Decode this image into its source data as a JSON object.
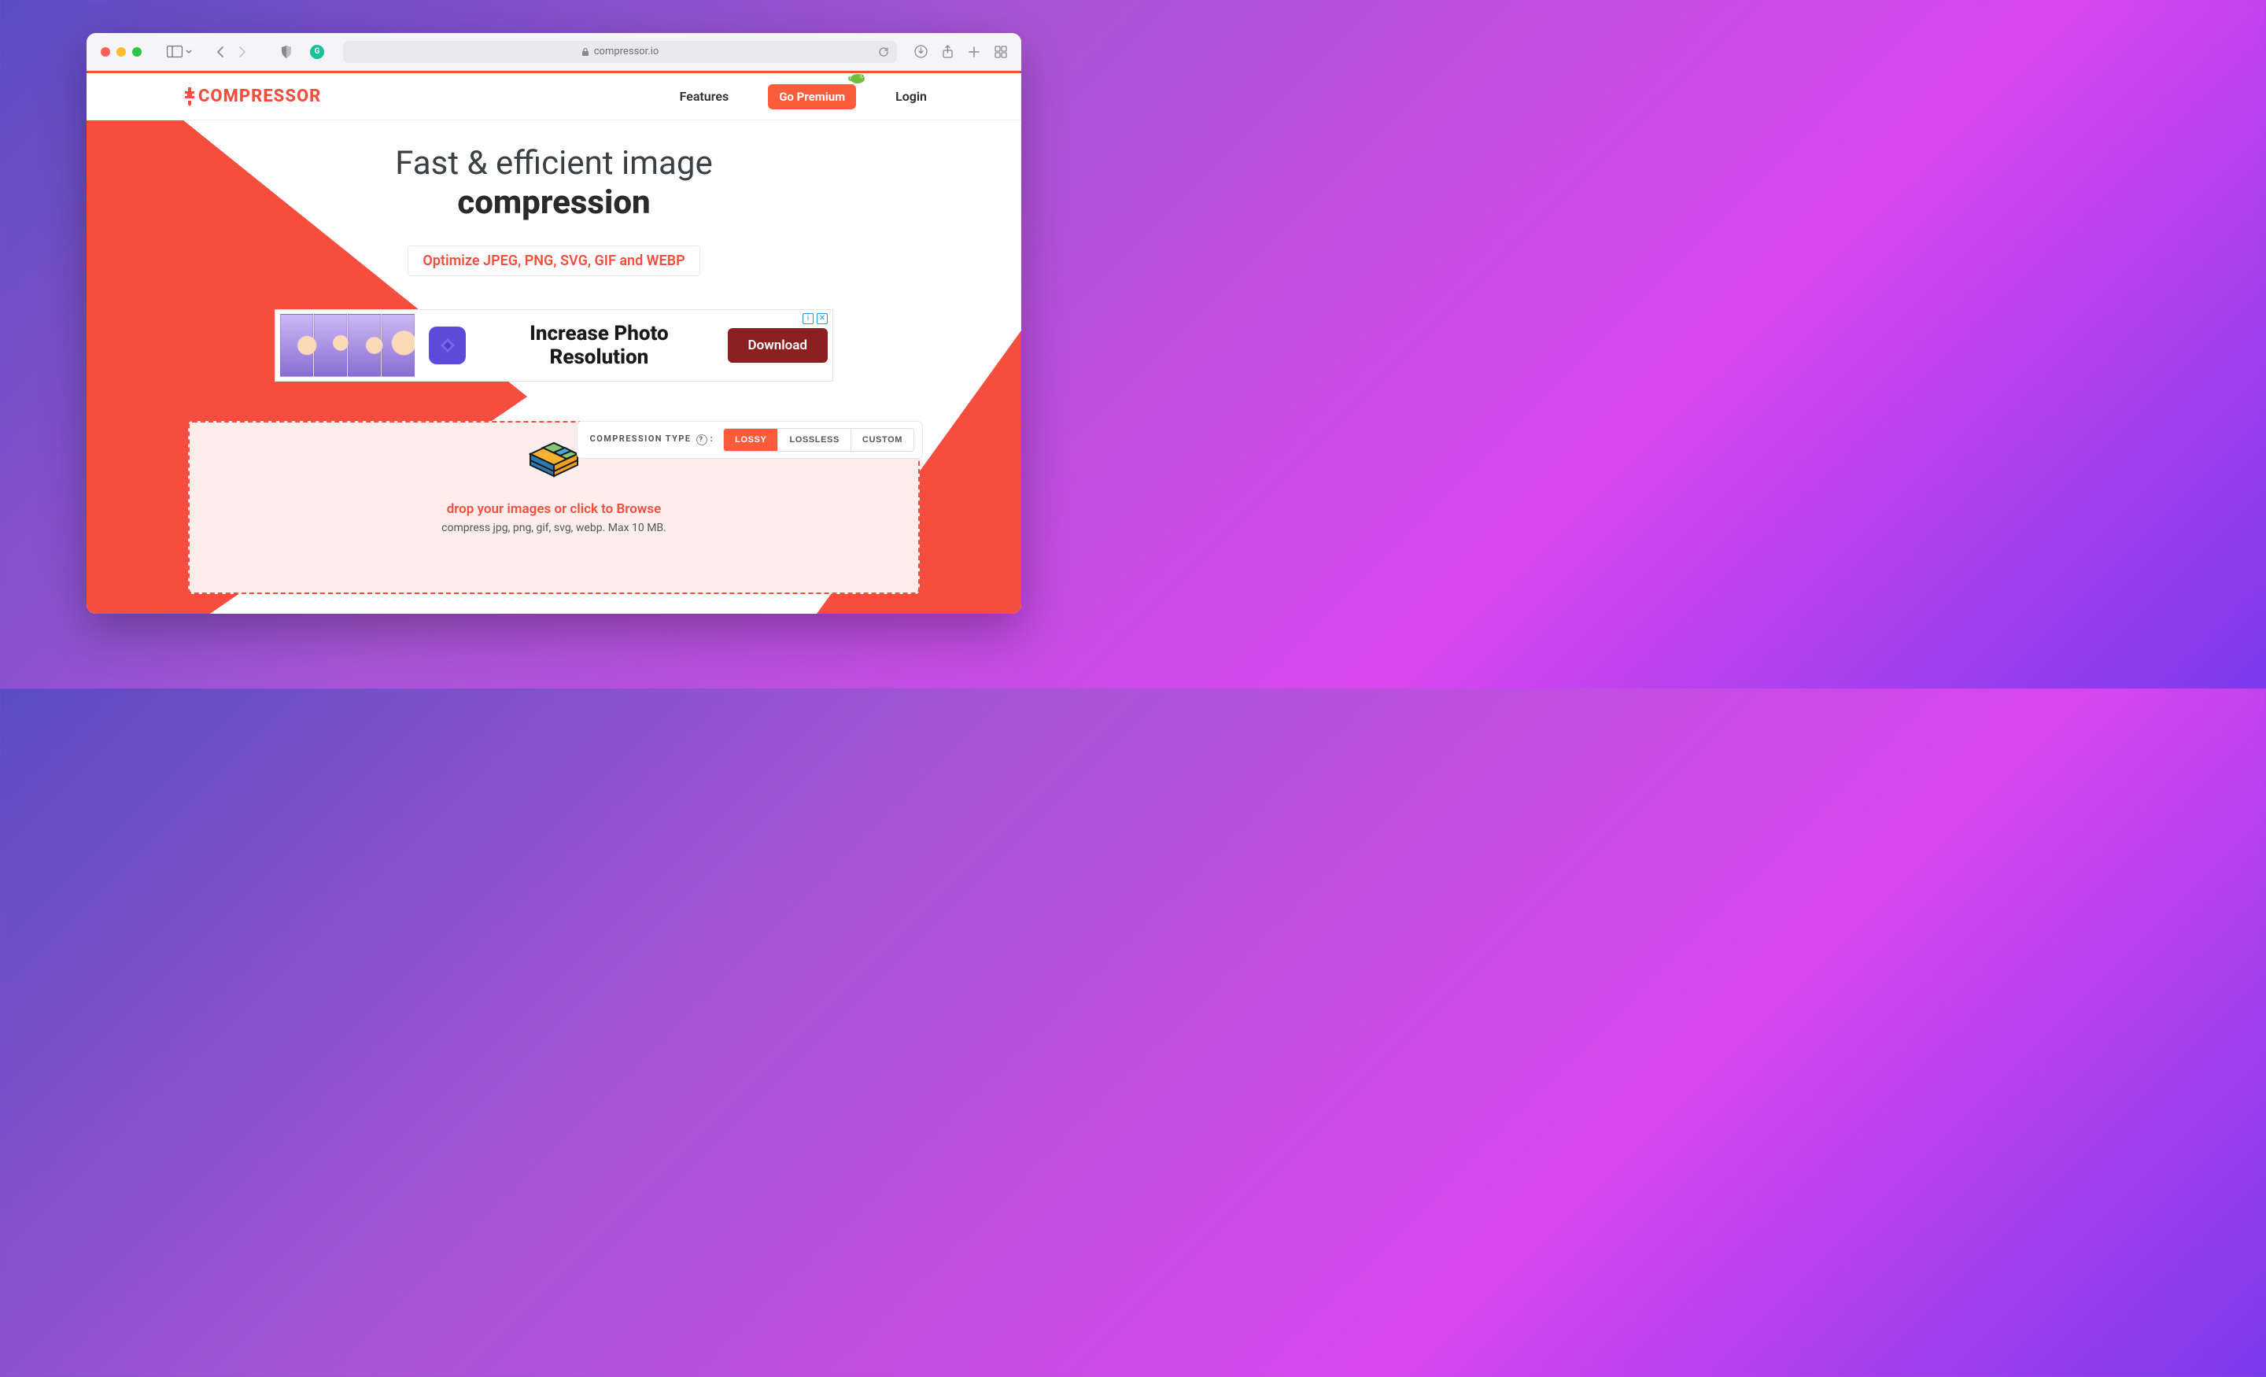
{
  "browser": {
    "url_host": "compressor.io"
  },
  "header": {
    "logo_text": "COMPRESSOR",
    "nav": {
      "features": "Features",
      "premium": "Go Premium",
      "login": "Login"
    }
  },
  "hero": {
    "title_line1": "Fast & efficient image",
    "title_line2": "compression",
    "subtitle": "Optimize JPEG, PNG, SVG, GIF and WEBP"
  },
  "ad": {
    "headline": "Increase Photo Resolution",
    "cta": "Download"
  },
  "compression": {
    "label": "COMPRESSION TYPE",
    "options": {
      "lossy": "LOSSY",
      "lossless": "LOSSLESS",
      "custom": "CUSTOM"
    },
    "drop_text": "drop your images or click to Browse",
    "drop_sub": "compress jpg, png, gif, svg, webp. Max 10 MB."
  }
}
